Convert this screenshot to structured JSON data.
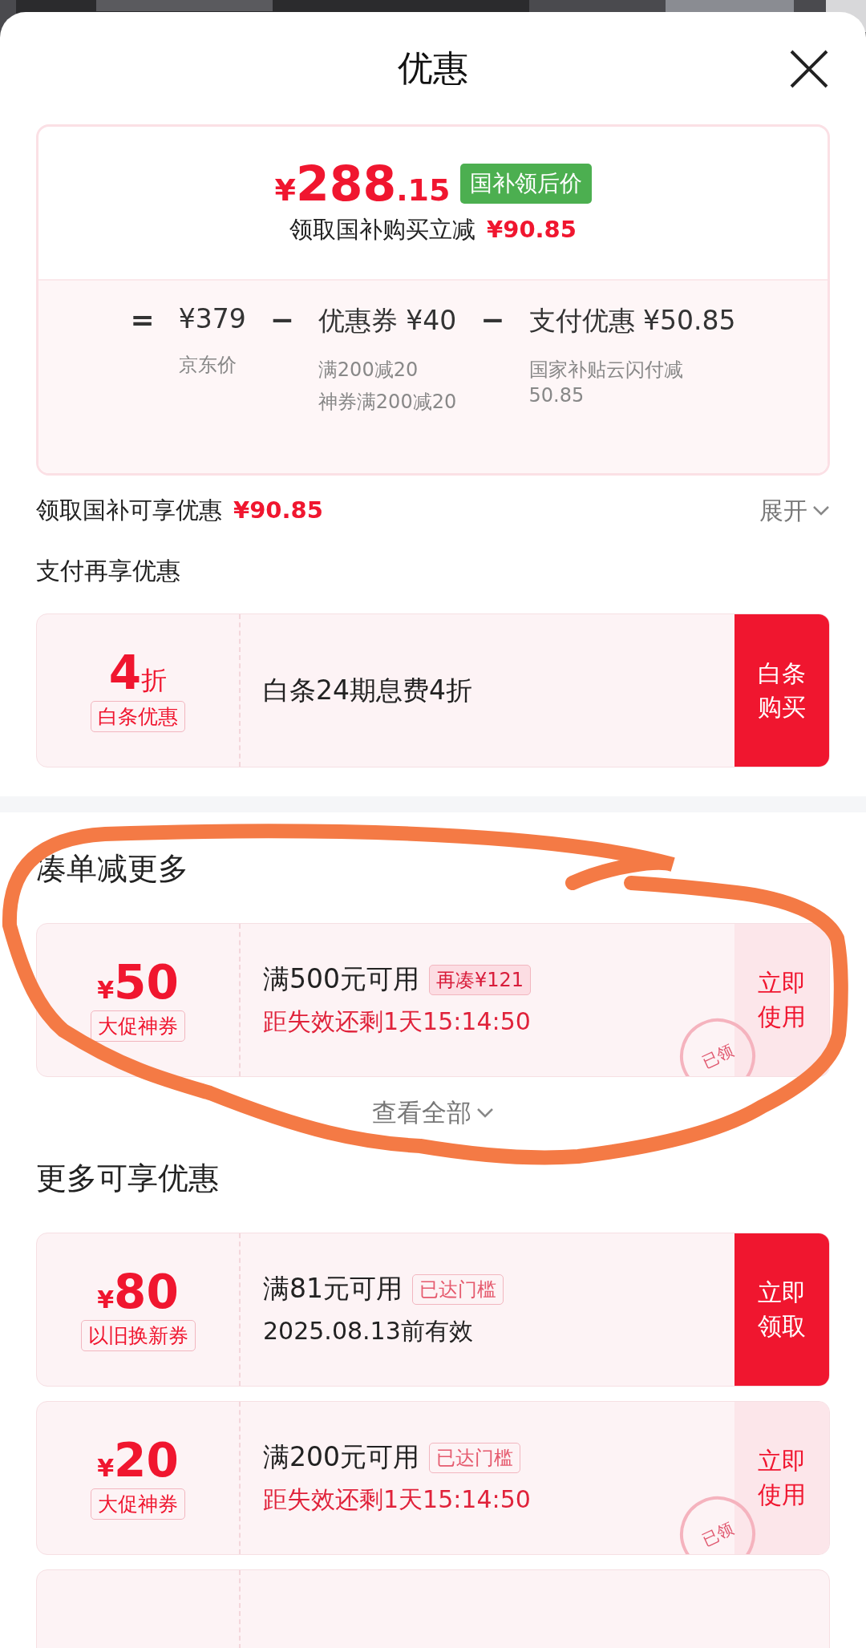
{
  "sheet": {
    "title": "优惠"
  },
  "summary": {
    "price": {
      "currency": "¥",
      "integer": "288",
      "decimal": ".15"
    },
    "price_badge": "国补领后价",
    "subtitle": "领取国补购买立减",
    "subtitle_amount": "¥90.85",
    "terms": [
      {
        "operator": "=",
        "value": "¥379",
        "notes": [
          "京东价"
        ]
      },
      {
        "operator": "−",
        "value": "优惠券 ¥40",
        "notes": [
          "满200减20",
          "神券满200减20"
        ]
      },
      {
        "operator": "−",
        "value": "支付优惠 ¥50.85",
        "notes": [
          "国家补贴云闪付减50.85"
        ]
      }
    ]
  },
  "subsidy_row": {
    "label": "领取国补可享优惠",
    "amount": "¥90.85",
    "toggle": "展开"
  },
  "sections": [
    {
      "title": "支付再享优惠",
      "coupons": [
        {
          "value": "4",
          "suffix": "折",
          "tag": "白条优惠",
          "title": "白条24期息费4折",
          "action": "白条购买",
          "action_primary": true
        }
      ]
    },
    {
      "divider": true,
      "title": "凑单减更多",
      "coupons": [
        {
          "prefix": "¥",
          "value": "50",
          "tag": "大促神券",
          "title": "满500元可用",
          "badge": "再凑¥121",
          "badge_filled": true,
          "detail": "距失效还剩1天15:14:50",
          "detail_urgent": true,
          "action": "立即使用",
          "action_primary": false,
          "stamp": "已领"
        }
      ],
      "more": "查看全部"
    },
    {
      "title": "更多可享优惠",
      "coupons": [
        {
          "prefix": "¥",
          "value": "80",
          "tag": "以旧换新券",
          "title": "满81元可用",
          "badge": "已达门槛",
          "badge_filled": false,
          "detail": "2025.08.13前有效",
          "detail_urgent": false,
          "action": "立即领取",
          "action_primary": true
        },
        {
          "prefix": "¥",
          "value": "20",
          "tag": "大促神券",
          "title": "满200元可用",
          "badge": "已达门槛",
          "badge_filled": false,
          "detail": "距失效还剩1天15:14:50",
          "detail_urgent": true,
          "action": "立即使用",
          "action_primary": false,
          "stamp": "已领"
        },
        {
          "kind": "cut"
        }
      ]
    }
  ]
}
